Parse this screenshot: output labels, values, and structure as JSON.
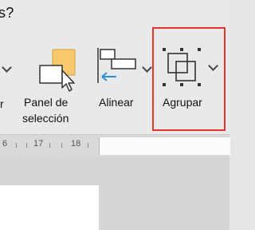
{
  "window": {
    "title_partial": "s?"
  },
  "ribbon": {
    "left_partial_label": "r",
    "tools": [
      {
        "line1": "Panel de",
        "line2": "selección",
        "icon": "selection-pane-icon"
      },
      {
        "line1": "Alinear",
        "icon": "align-icon"
      },
      {
        "line1": "Agrupar",
        "icon": "group-icon",
        "highlighted": true
      }
    ]
  },
  "ruler": {
    "numbers": [
      "6",
      "17",
      "18"
    ]
  },
  "colors": {
    "highlight": "#e1352a",
    "selection_pane_fill": "#f7c86c",
    "align_arrow": "#2d8fd8"
  }
}
